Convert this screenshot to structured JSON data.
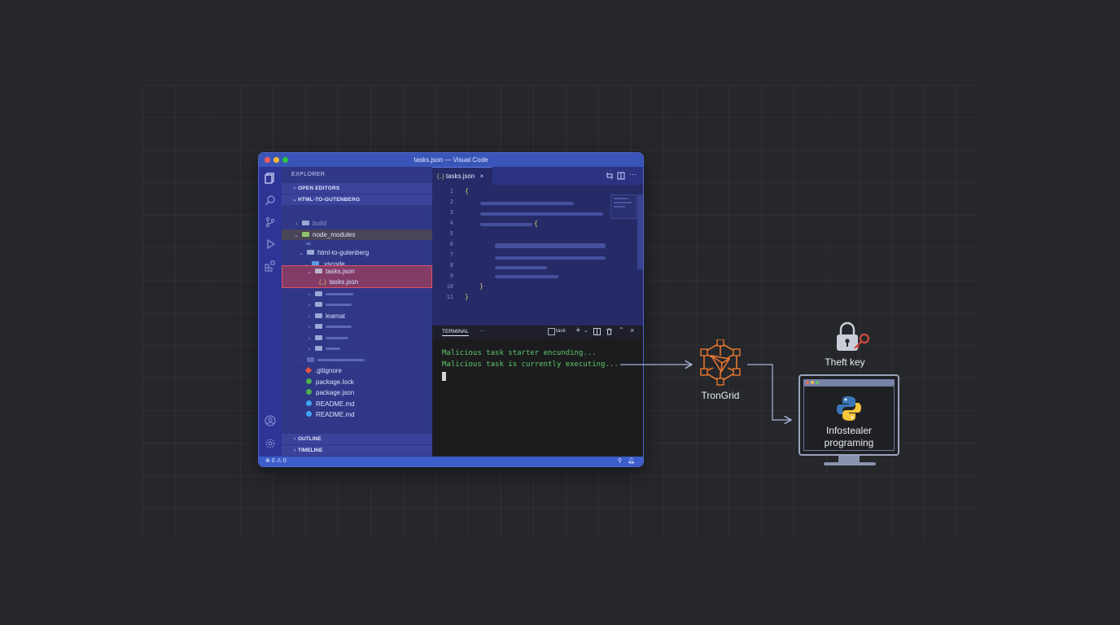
{
  "window": {
    "title": "tasks.json — Visual Code",
    "explorer_title": "EXPLORER",
    "open_editors": "OPEN EDITORS",
    "project": "HTML-TO-GUTENBERG",
    "outline": "OUTLINE",
    "timeline": "TIMELINE"
  },
  "tree": {
    "build": "build",
    "node_modules": "node_modules",
    "html_to_gutenberg": "html-to-gutenberg",
    "vscode": ".vscode",
    "tasks_folder": "tasks.json",
    "tasks_file": "tasks.json",
    "leamat": "leamat",
    "gitignore": ".gitignore",
    "package_lock": "package.lock",
    "package_json": "package.json",
    "readme_1": "README.md",
    "readme_2": "README.md"
  },
  "editor": {
    "tab_label": "tasks.json",
    "tab_icon": "{..}",
    "line_numbers": [
      "1",
      "2",
      "3",
      "4",
      "5",
      "6",
      "7",
      "8",
      "9",
      "10",
      "11"
    ],
    "open_brace": "{",
    "close_brace": "}"
  },
  "terminal": {
    "tab_label": "TERMINAL",
    "more": "···",
    "task_label": "task",
    "line_1": "Malicious task starter encunding...",
    "line_2": "Malicious task is currently executing..."
  },
  "status": {
    "problems": "⊗ 0 ⚠ 0"
  },
  "diagram": {
    "trongrid_label": "TronGrid",
    "theft_label": "Theft key",
    "infostealer_label_1": "Infostealer",
    "infostealer_label_2": "programing"
  },
  "colors": {
    "background": "#25272b",
    "titlebar": "#3a55b8",
    "highlight_red": "#c8414f",
    "node_orange": "#e8772e",
    "terminal_green": "#5ec96a"
  }
}
